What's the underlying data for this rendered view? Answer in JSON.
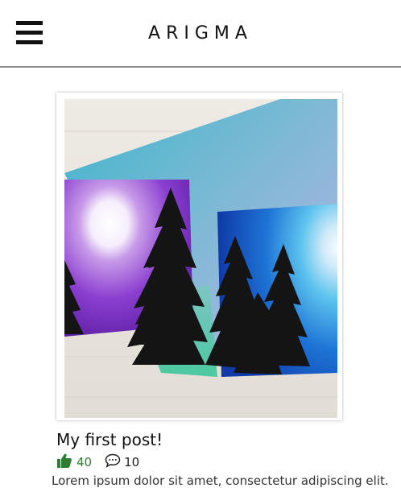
{
  "header": {
    "brand": "ARIGMA",
    "menu_icon": "hamburger-menu-icon"
  },
  "post": {
    "title": "My first post!",
    "likes": "40",
    "comments": "10",
    "excerpt": "Lorem ipsum dolor sit amet, consectetur adipiscing elit.",
    "like_icon": "thumbs-up-icon",
    "comment_icon": "speech-bubble-icon"
  },
  "colors": {
    "like": "#2e7d32",
    "divider": "#8a8a8a"
  }
}
